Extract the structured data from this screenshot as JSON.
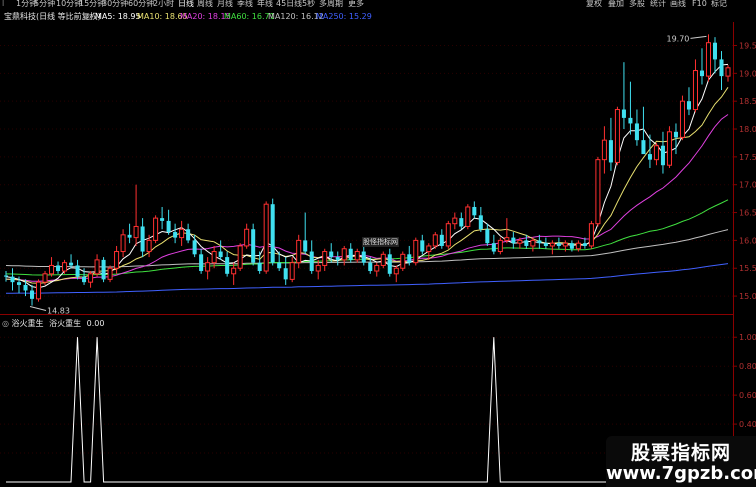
{
  "toolbar": {
    "items": [
      "1分钟",
      "5分钟",
      "10分钟",
      "15分钟",
      "30分钟",
      "60分钟",
      "2小时",
      "日线",
      "周线",
      "月线",
      "季线",
      "年线",
      "45日线",
      "5秒",
      "多周期",
      "更多"
    ],
    "active_index": 7,
    "left_glyph": "l",
    "right_items": [
      "复权",
      "叠加",
      "多股",
      "统计",
      "画线",
      "F10",
      "标记"
    ]
  },
  "infoline": {
    "stock_title": "宝鼎科技(日线 等比前复权)",
    "ma5": "MA5: 18.95",
    "ma10": "MA10: 18.65",
    "ma20": "MA20: 18.15",
    "ma60": "MA60: 16.71",
    "ma120": "MA120: 16.12",
    "ma250": "MA250: 15.29",
    "colors": {
      "ma5": "#ffffff",
      "ma10": "#e8e070",
      "ma20": "#e040e0",
      "ma60": "#40e040",
      "ma120": "#c0c0c0",
      "ma250": "#4060ff"
    }
  },
  "price_axis": {
    "labels": [
      "19.5",
      "19.0",
      "18.5",
      "18.0",
      "17.5",
      "17.0",
      "16.5",
      "16.0",
      "15.5",
      "15.0"
    ]
  },
  "annotations": {
    "high": "19.70",
    "low": "14.83",
    "watermark_mid": "股怪指标网"
  },
  "indicator": {
    "title1": "浴火重生",
    "title2": "浴火重生",
    "value": "0.00",
    "axis_labels": [
      "1.00",
      "0.80",
      "0.60",
      "0.40",
      "0.20"
    ]
  },
  "watermark": {
    "line1": "股票指标网",
    "line2": "www.7gpzb.com"
  },
  "chart_data": {
    "type": "candlestick",
    "candles": [
      [
        15.37,
        15.45,
        15.26,
        15.35
      ],
      [
        15.35,
        15.5,
        15.1,
        15.25
      ],
      [
        15.25,
        15.35,
        15.05,
        15.2
      ],
      [
        15.2,
        15.3,
        15.0,
        15.1
      ],
      [
        15.1,
        15.2,
        14.83,
        14.95
      ],
      [
        14.95,
        15.3,
        14.9,
        15.25
      ],
      [
        15.25,
        15.45,
        15.2,
        15.4
      ],
      [
        15.4,
        15.7,
        15.35,
        15.55
      ],
      [
        15.55,
        15.62,
        15.4,
        15.45
      ],
      [
        15.45,
        15.65,
        15.4,
        15.6
      ],
      [
        15.6,
        15.75,
        15.5,
        15.55
      ],
      [
        15.55,
        15.65,
        15.3,
        15.35
      ],
      [
        15.35,
        15.5,
        15.2,
        15.25
      ],
      [
        15.25,
        15.45,
        15.15,
        15.4
      ],
      [
        15.4,
        15.75,
        15.35,
        15.65
      ],
      [
        15.65,
        15.7,
        15.25,
        15.3
      ],
      [
        15.3,
        15.55,
        15.25,
        15.5
      ],
      [
        15.5,
        15.9,
        15.4,
        15.8
      ],
      [
        15.8,
        16.2,
        15.7,
        16.1
      ],
      [
        16.1,
        16.3,
        15.95,
        16.05
      ],
      [
        16.05,
        17.0,
        15.9,
        16.25
      ],
      [
        16.25,
        16.4,
        15.7,
        15.8
      ],
      [
        15.8,
        16.1,
        15.7,
        16.0
      ],
      [
        16.0,
        16.45,
        15.95,
        16.4
      ],
      [
        16.4,
        16.6,
        16.2,
        16.35
      ],
      [
        16.35,
        16.55,
        16.1,
        16.15
      ],
      [
        16.15,
        16.3,
        15.95,
        16.05
      ],
      [
        16.05,
        16.35,
        15.9,
        16.2
      ],
      [
        16.2,
        16.3,
        15.95,
        16.0
      ],
      [
        16.0,
        16.1,
        15.7,
        15.75
      ],
      [
        15.75,
        15.85,
        15.4,
        15.45
      ],
      [
        15.45,
        15.7,
        15.3,
        15.6
      ],
      [
        15.6,
        15.9,
        15.5,
        15.8
      ],
      [
        15.8,
        16.0,
        15.65,
        15.7
      ],
      [
        15.7,
        15.8,
        15.35,
        15.4
      ],
      [
        15.4,
        15.6,
        15.2,
        15.5
      ],
      [
        15.5,
        15.95,
        15.45,
        15.9
      ],
      [
        15.9,
        16.3,
        15.85,
        16.2
      ],
      [
        16.2,
        16.3,
        15.55,
        15.6
      ],
      [
        15.6,
        15.8,
        15.4,
        15.45
      ],
      [
        15.45,
        16.7,
        15.4,
        16.65
      ],
      [
        16.65,
        16.75,
        15.55,
        15.6
      ],
      [
        15.6,
        15.8,
        15.45,
        15.5
      ],
      [
        15.5,
        15.7,
        15.2,
        15.3
      ],
      [
        15.3,
        15.7,
        15.25,
        15.6
      ],
      [
        15.6,
        16.1,
        15.5,
        16.0
      ],
      [
        16.0,
        16.5,
        15.75,
        15.8
      ],
      [
        15.8,
        16.0,
        15.4,
        15.45
      ],
      [
        15.45,
        15.65,
        15.3,
        15.55
      ],
      [
        15.55,
        15.85,
        15.45,
        15.8
      ],
      [
        15.8,
        15.95,
        15.6,
        15.7
      ],
      [
        15.7,
        15.8,
        15.55,
        15.65
      ],
      [
        15.65,
        15.9,
        15.55,
        15.85
      ],
      [
        15.85,
        15.95,
        15.6,
        15.65
      ],
      [
        15.65,
        15.85,
        15.6,
        15.8
      ],
      [
        15.8,
        15.9,
        15.55,
        15.6
      ],
      [
        15.6,
        15.7,
        15.4,
        15.45
      ],
      [
        15.45,
        15.6,
        15.35,
        15.55
      ],
      [
        15.55,
        15.8,
        15.5,
        15.75
      ],
      [
        15.75,
        15.85,
        15.35,
        15.4
      ],
      [
        15.4,
        15.55,
        15.25,
        15.5
      ],
      [
        15.5,
        15.8,
        15.45,
        15.75
      ],
      [
        15.75,
        15.9,
        15.55,
        15.6
      ],
      [
        15.6,
        16.05,
        15.55,
        16.0
      ],
      [
        16.0,
        16.1,
        15.75,
        15.8
      ],
      [
        15.8,
        15.95,
        15.65,
        15.9
      ],
      [
        15.9,
        16.15,
        15.85,
        16.1
      ],
      [
        16.1,
        16.2,
        15.85,
        15.9
      ],
      [
        15.9,
        16.35,
        15.85,
        16.3
      ],
      [
        16.3,
        16.5,
        16.2,
        16.4
      ],
      [
        16.4,
        16.5,
        16.2,
        16.25
      ],
      [
        16.25,
        16.65,
        16.2,
        16.6
      ],
      [
        16.6,
        16.7,
        16.4,
        16.45
      ],
      [
        16.45,
        16.6,
        16.15,
        16.2
      ],
      [
        16.2,
        16.3,
        15.9,
        15.95
      ],
      [
        15.95,
        16.1,
        15.75,
        15.8
      ],
      [
        15.8,
        16.05,
        15.75,
        16.0
      ],
      [
        16.0,
        16.4,
        15.95,
        16.05
      ],
      [
        16.05,
        16.15,
        15.85,
        15.95
      ],
      [
        15.95,
        16.05,
        15.85,
        16.0
      ],
      [
        16.0,
        16.1,
        15.85,
        15.9
      ],
      [
        15.9,
        16.05,
        15.8,
        16.0
      ],
      [
        16.0,
        16.1,
        15.85,
        15.95
      ],
      [
        15.95,
        16.05,
        15.85,
        15.9
      ],
      [
        15.9,
        16.0,
        15.75,
        15.95
      ],
      [
        15.95,
        16.05,
        15.85,
        15.9
      ],
      [
        15.9,
        16.0,
        15.8,
        15.95
      ],
      [
        15.95,
        16.0,
        15.8,
        15.85
      ],
      [
        15.85,
        16.0,
        15.8,
        15.95
      ],
      [
        15.95,
        16.05,
        15.85,
        15.9
      ],
      [
        15.9,
        16.35,
        15.85,
        16.3
      ],
      [
        16.3,
        17.5,
        16.25,
        17.45
      ],
      [
        17.45,
        18.05,
        17.2,
        17.8
      ],
      [
        17.8,
        18.2,
        17.25,
        17.4
      ],
      [
        17.4,
        18.4,
        17.35,
        18.35
      ],
      [
        18.35,
        19.2,
        18.0,
        18.2
      ],
      [
        18.2,
        18.85,
        17.9,
        18.1
      ],
      [
        18.1,
        18.35,
        17.7,
        17.8
      ],
      [
        17.8,
        18.4,
        17.65,
        17.55
      ],
      [
        17.55,
        17.9,
        17.3,
        17.45
      ],
      [
        17.45,
        17.75,
        17.35,
        17.7
      ],
      [
        17.7,
        17.95,
        17.2,
        17.35
      ],
      [
        17.35,
        18.05,
        17.3,
        17.95
      ],
      [
        17.95,
        18.1,
        17.55,
        17.85
      ],
      [
        17.85,
        18.6,
        17.8,
        18.5
      ],
      [
        18.5,
        18.75,
        18.25,
        18.35
      ],
      [
        18.35,
        19.25,
        18.3,
        19.05
      ],
      [
        19.05,
        19.45,
        18.8,
        18.95
      ],
      [
        18.95,
        19.7,
        18.85,
        19.55
      ],
      [
        19.55,
        19.65,
        19.0,
        19.25
      ],
      [
        19.25,
        19.4,
        18.7,
        18.95
      ],
      [
        18.95,
        19.15,
        18.85,
        19.1
      ]
    ],
    "ylim": [
      14.75,
      19.85
    ],
    "indicator_signals": [
      11,
      14,
      75
    ],
    "indicator_ylim": [
      0,
      1.05
    ]
  }
}
